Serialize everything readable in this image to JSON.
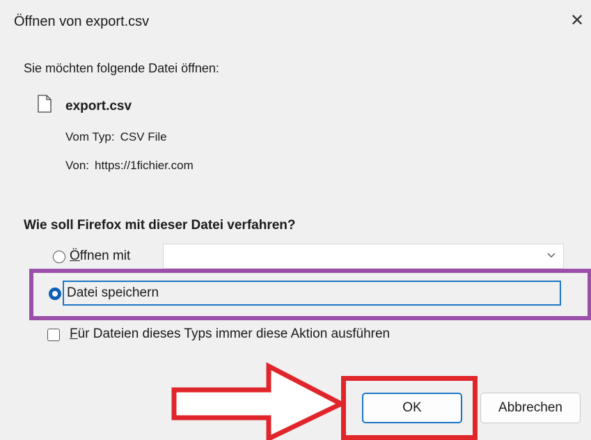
{
  "dialog": {
    "title": "Öffnen von export.csv",
    "close_icon": "close-icon"
  },
  "file": {
    "prompt": "Sie möchten folgende Datei öffnen:",
    "name": "export.csv",
    "icon": "file-icon",
    "type_label": "Vom Typ:",
    "type_value": "CSV File",
    "from_label": "Von:",
    "from_value": "https://1fichier.com"
  },
  "action": {
    "question": "Wie soll Firefox mit dieser Datei verfahren?",
    "open_with_label": "Öffnen mit",
    "open_with_selected": false,
    "open_with_value": "",
    "save_label": "Datei speichern",
    "save_selected": true,
    "always_label": "Für Dateien dieses Typs immer diese Aktion ausführen",
    "always_checked": false
  },
  "buttons": {
    "ok_label": "OK",
    "cancel_label": "Abbrechen"
  },
  "annotations": {
    "purple_box_color": "#9b4fa8",
    "red_box_color": "#e0262b",
    "arrow_icon": "right-arrow-icon"
  }
}
